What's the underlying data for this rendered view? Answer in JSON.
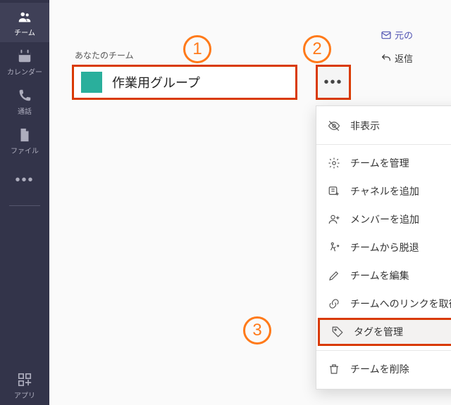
{
  "sidebar": {
    "items": [
      {
        "label": "チーム"
      },
      {
        "label": "カレンダー"
      },
      {
        "label": "通話"
      },
      {
        "label": "ファイル"
      }
    ],
    "apps_label": "アプリ"
  },
  "main": {
    "section_label": "あなたのチーム",
    "team_name": "作業用グループ",
    "original_link": "元の",
    "reply_label": "返信"
  },
  "menu": {
    "hide": "非表示",
    "manage_team": "チームを管理",
    "add_channel": "チャネルを追加",
    "add_member": "メンバーを追加",
    "leave_team": "チームから脱退",
    "edit_team": "チームを編集",
    "get_link": "チームへのリンクを取得",
    "manage_tags": "タグを管理",
    "delete_team": "チームを削除"
  },
  "callouts": {
    "one": "1",
    "two": "2",
    "three": "3"
  }
}
